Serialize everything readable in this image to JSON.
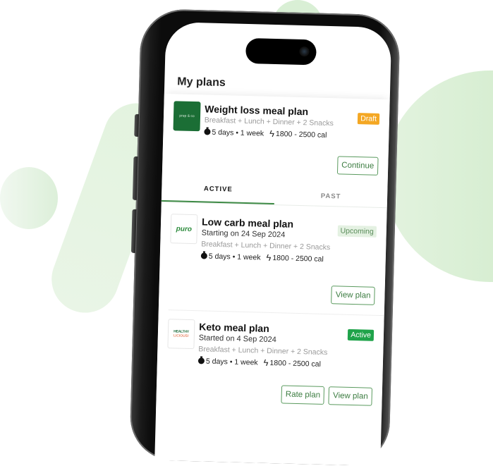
{
  "screen": {
    "title": "My plans"
  },
  "tabs": [
    {
      "label": "ACTIVE",
      "selected": true
    },
    {
      "label": "PAST",
      "selected": false
    }
  ],
  "draft_plan": {
    "logo": "prep & co",
    "title": "Weight loss meal plan",
    "meals": "Breakfast + Lunch + Dinner + 2 Snacks",
    "duration": "5 days • 1 week",
    "calories": "1800 - 2500 cal",
    "badge": "Draft",
    "actions": [
      "Continue"
    ]
  },
  "plans": [
    {
      "logo": "puro",
      "title": "Low carb meal plan",
      "date": "Starting on 24 Sep 2024",
      "meals": "Breakfast + Lunch + Dinner + 2 Snacks",
      "duration": "5 days • 1 week",
      "calories": "1800 - 2500 cal",
      "badge": "Upcoming",
      "actions": [
        "View plan"
      ]
    },
    {
      "logo_line1": "HEALTHY",
      "logo_line2": "LICIOUS!",
      "title": "Keto meal plan",
      "date": "Started on 4 Sep 2024",
      "meals": "Breakfast + Lunch + Dinner + 2 Snacks",
      "duration": "5 days • 1 week",
      "calories": "1800 - 2500 cal",
      "badge": "Active",
      "actions": [
        "Rate plan",
        "View plan"
      ]
    }
  ],
  "colors": {
    "accent": "#3d8a45",
    "draft": "#f4a723",
    "upcoming_bg": "#e4f1e2",
    "active": "#1fa34a"
  }
}
